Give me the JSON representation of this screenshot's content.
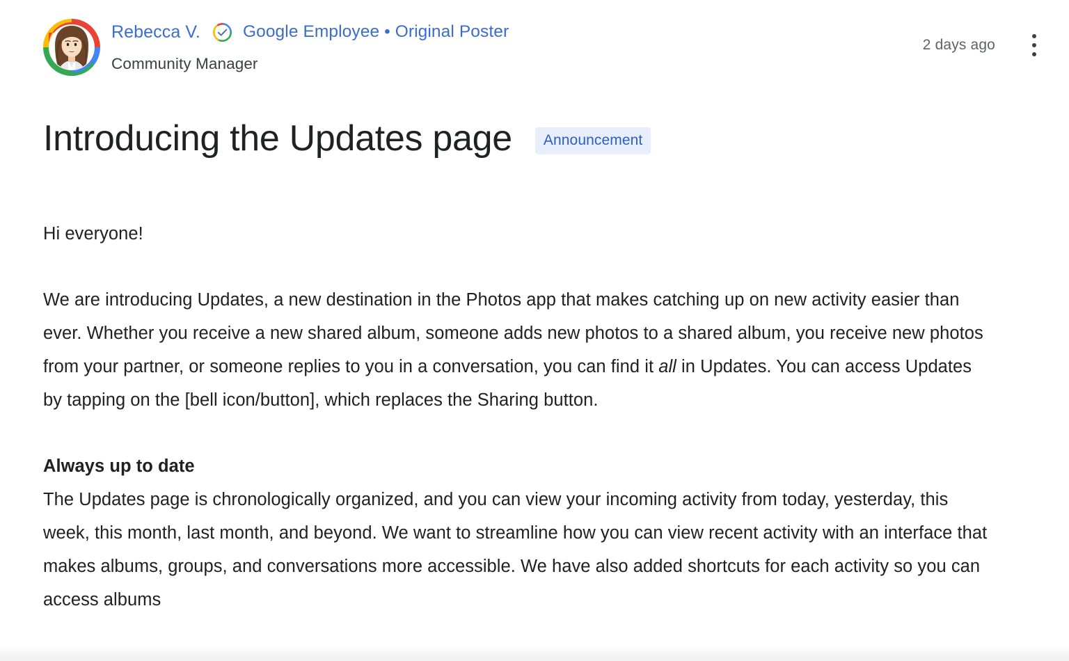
{
  "post": {
    "author": {
      "name": "Rebecca V.",
      "roles": "Google Employee • Original Poster",
      "subtitle": "Community Manager",
      "verified_icon": "google-verified-check-icon",
      "avatar_icon": "user-avatar-illustration"
    },
    "timestamp": "2 days ago",
    "overflow_icon": "more-vertical-icon",
    "title": "Introducing the Updates page",
    "badge": {
      "label": "Announcement",
      "background": "#e8eefb",
      "text_color": "#2b5fc4"
    },
    "body": {
      "greeting": "Hi everyone!",
      "paragraph_1_a": "We are introducing Updates, a new destination in the Photos app that makes catching up on new activity easier than ever. Whether you receive a new shared album, someone adds new photos to a shared album, you receive new photos from your partner, or someone replies to you in a conversation, you can find it ",
      "paragraph_1_italic": "all",
      "paragraph_1_b": " in Updates. You can access Updates by tapping on the [bell icon/button], which replaces the Sharing button.",
      "section_heading": "Always up to date",
      "paragraph_2": "The Updates page is chronologically organized, and you can view your incoming activity from today, yesterday, this week, this month, last month, and beyond. We want to streamline how you can view recent activity with an interface that makes albums, groups, and conversations more accessible. We have also added shortcuts for each activity so you can access albums"
    }
  },
  "colors": {
    "link_blue": "#3b6ecc",
    "text_primary": "#202124",
    "text_secondary": "#5f6368",
    "page_background": "#ffffff",
    "google_blue": "#4285f4",
    "google_red": "#ea4335",
    "google_yellow": "#fbbc05",
    "google_green": "#34a853"
  }
}
